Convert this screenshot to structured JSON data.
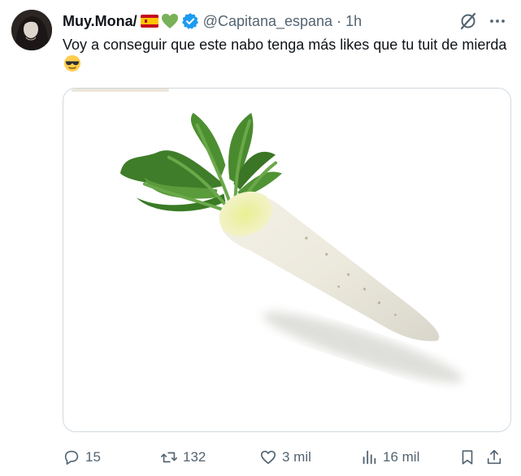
{
  "tweet": {
    "author_name": "Muy.Mona/",
    "handle": "@Capitana_espana",
    "separator": "·",
    "time": "1h",
    "text": "Voy a conseguir que este nabo tenga más likes que tu tuit de mierda",
    "emojis": [
      "spain-flag",
      "green-heart",
      "sunglasses-face"
    ],
    "verified": true
  },
  "actions": {
    "replies": "15",
    "reposts": "132",
    "likes": "3 mil",
    "views": "16 mil"
  },
  "colors": {
    "text": "#0f1419",
    "secondary": "#536471",
    "verified": "#1d9bf0",
    "border": "#cfd9de"
  }
}
